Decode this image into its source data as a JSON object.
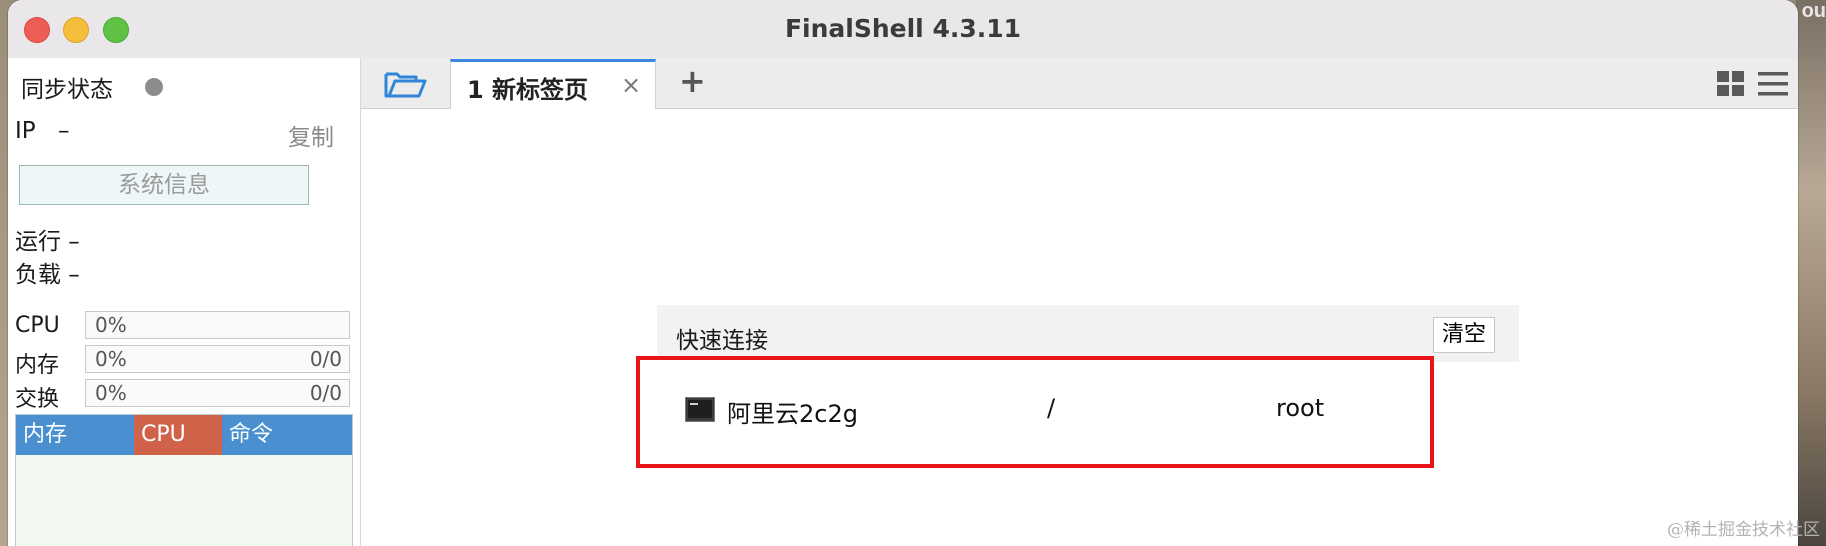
{
  "desktop": {
    "corner_text": "ou"
  },
  "window": {
    "title": "FinalShell 4.3.11"
  },
  "sidebar": {
    "sync_label": "同步状态",
    "ip_label": "IP",
    "ip_value": "–",
    "copy_label": "复制",
    "sysinfo_label": "系统信息",
    "run_label": "运行 –",
    "load_label": "负载 –",
    "meters": [
      {
        "label": "CPU",
        "percent": "0%",
        "right": ""
      },
      {
        "label": "内存",
        "percent": "0%",
        "right": "0/0"
      },
      {
        "label": "交换",
        "percent": "0%",
        "right": "0/0"
      }
    ],
    "process_tabs": [
      "内存",
      "CPU",
      "命令"
    ]
  },
  "tabs": {
    "active_label": "1  新标签页",
    "close_glyph": "×",
    "add_glyph": "+"
  },
  "quick_connect": {
    "title": "快速连接",
    "clear_label": "清空",
    "entries": [
      {
        "name": "阿里云2c2g",
        "path": "/",
        "user": "root"
      }
    ]
  },
  "watermark": "@稀土掘金技术社区",
  "colors": {
    "active_tab_accent": "#3a86e0",
    "highlight_box": "#e8141a",
    "mem_tab": "#4a8fd0",
    "cpu_tab": "#d0624a"
  }
}
